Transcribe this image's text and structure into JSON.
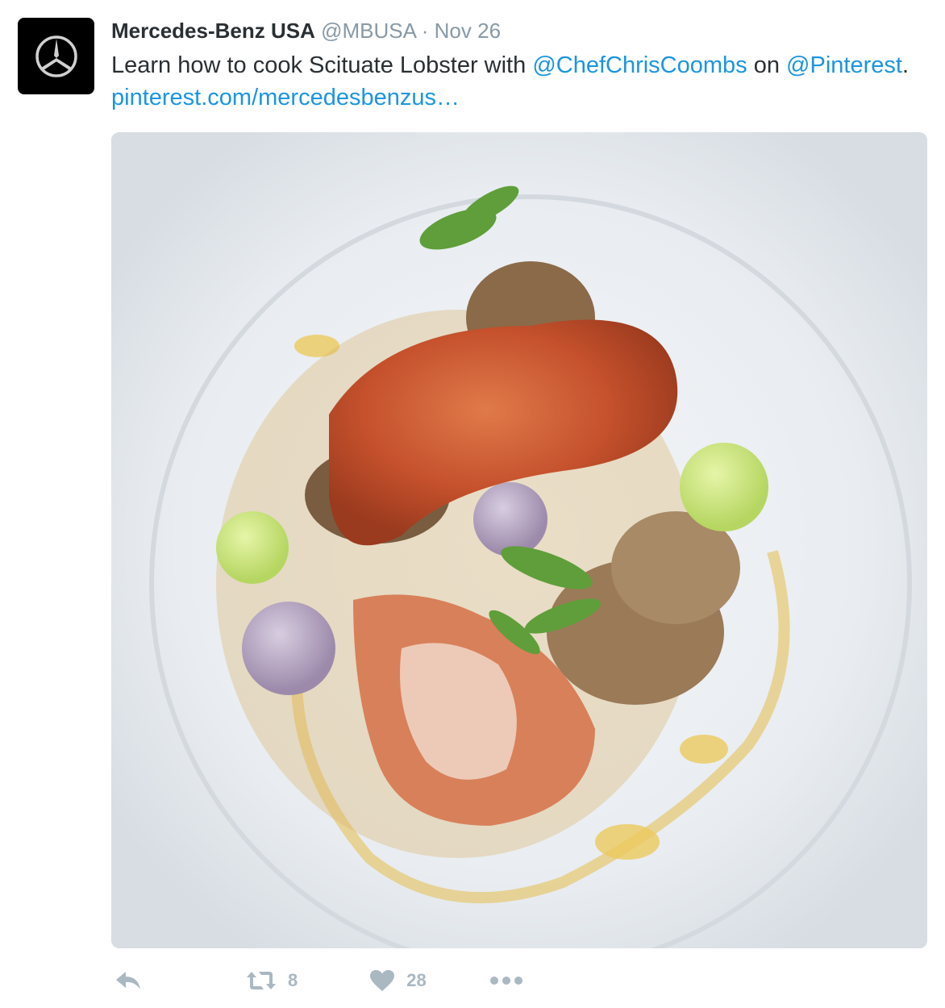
{
  "tweet": {
    "author_name": "Mercedes-Benz USA",
    "handle": "@MBUSA",
    "separator": "·",
    "timestamp": "Nov 26",
    "text": {
      "part1": "Learn how to cook Scituate Lobster with ",
      "mention1": "@ChefChrisCoombs",
      "part2": " on ",
      "mention2": "@Pinterest",
      "part3": ". ",
      "link": "pinterest.com/mercedesbenzus…"
    },
    "media": {
      "icon": "photo-lobster-dish"
    },
    "actions": {
      "retweet_count": "8",
      "like_count": "28"
    }
  },
  "colors": {
    "link": "#1b95e0",
    "text": "#292f33",
    "muted": "#8899a6",
    "action_icon": "#aab8c2",
    "avatar_bg": "#000000"
  },
  "icons": [
    "mercedes-star-logo",
    "reply-icon",
    "retweet-icon",
    "heart-icon",
    "more-icon"
  ]
}
